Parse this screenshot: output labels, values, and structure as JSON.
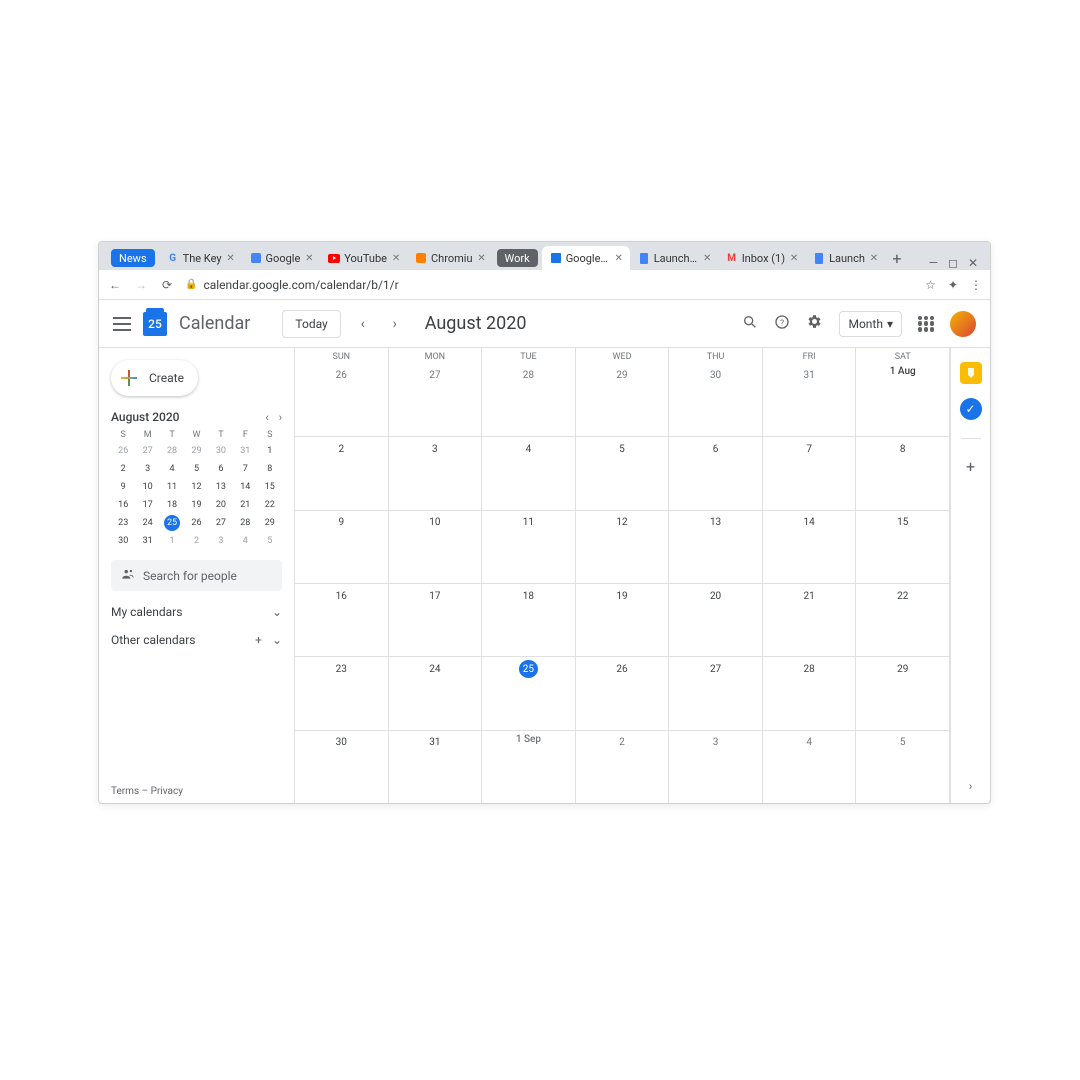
{
  "browser": {
    "tabs": [
      {
        "label": "News",
        "type": "group"
      },
      {
        "label": "The Key",
        "icon": "G"
      },
      {
        "label": "Google",
        "icon": "GB"
      },
      {
        "label": "YouTube",
        "icon": "YT"
      },
      {
        "label": "Chromiu",
        "icon": "B"
      },
      {
        "label": "Work",
        "type": "group"
      },
      {
        "label": "Google C",
        "icon": "CAL",
        "active": true
      },
      {
        "label": "Launch Pr",
        "icon": "DOC"
      },
      {
        "label": "Inbox (1)",
        "icon": "M"
      },
      {
        "label": "Launch",
        "icon": "DOC"
      }
    ],
    "url": "calendar.google.com/calendar/b/1/r"
  },
  "header": {
    "logo_day": "25",
    "app_title": "Calendar",
    "today": "Today",
    "month_title": "August 2020",
    "view": "Month"
  },
  "sidebar": {
    "create": "Create",
    "mini_title": "August 2020",
    "dow": [
      "S",
      "M",
      "T",
      "W",
      "T",
      "F",
      "S"
    ],
    "mini_weeks": [
      [
        {
          "d": "26",
          "m": 1
        },
        {
          "d": "27",
          "m": 1
        },
        {
          "d": "28",
          "m": 1
        },
        {
          "d": "29",
          "m": 1
        },
        {
          "d": "30",
          "m": 1
        },
        {
          "d": "31",
          "m": 1
        },
        {
          "d": "1"
        }
      ],
      [
        {
          "d": "2"
        },
        {
          "d": "3"
        },
        {
          "d": "4"
        },
        {
          "d": "5"
        },
        {
          "d": "6"
        },
        {
          "d": "7"
        },
        {
          "d": "8"
        }
      ],
      [
        {
          "d": "9"
        },
        {
          "d": "10"
        },
        {
          "d": "11"
        },
        {
          "d": "12"
        },
        {
          "d": "13"
        },
        {
          "d": "14"
        },
        {
          "d": "15"
        }
      ],
      [
        {
          "d": "16"
        },
        {
          "d": "17"
        },
        {
          "d": "18"
        },
        {
          "d": "19"
        },
        {
          "d": "20"
        },
        {
          "d": "21"
        },
        {
          "d": "22"
        }
      ],
      [
        {
          "d": "23"
        },
        {
          "d": "24"
        },
        {
          "d": "25",
          "t": 1
        },
        {
          "d": "26"
        },
        {
          "d": "27"
        },
        {
          "d": "28"
        },
        {
          "d": "29"
        }
      ],
      [
        {
          "d": "30"
        },
        {
          "d": "31"
        },
        {
          "d": "1",
          "m": 1
        },
        {
          "d": "2",
          "m": 1
        },
        {
          "d": "3",
          "m": 1
        },
        {
          "d": "4",
          "m": 1
        },
        {
          "d": "5",
          "m": 1
        }
      ]
    ],
    "search_placeholder": "Search for people",
    "my_calendars": "My calendars",
    "other_calendars": "Other calendars",
    "terms": "Terms",
    "privacy": "Privacy"
  },
  "grid": {
    "dow": [
      "SUN",
      "MON",
      "TUE",
      "WED",
      "THU",
      "FRI",
      "SAT"
    ],
    "weeks": [
      [
        {
          "d": "26",
          "m": 1
        },
        {
          "d": "27",
          "m": 1
        },
        {
          "d": "28",
          "m": 1
        },
        {
          "d": "29",
          "m": 1
        },
        {
          "d": "30",
          "m": 1
        },
        {
          "d": "31",
          "m": 1
        },
        {
          "d": "1 Aug",
          "label": 1
        }
      ],
      [
        {
          "d": "2"
        },
        {
          "d": "3"
        },
        {
          "d": "4"
        },
        {
          "d": "5"
        },
        {
          "d": "6"
        },
        {
          "d": "7"
        },
        {
          "d": "8"
        }
      ],
      [
        {
          "d": "9"
        },
        {
          "d": "10"
        },
        {
          "d": "11"
        },
        {
          "d": "12"
        },
        {
          "d": "13"
        },
        {
          "d": "14"
        },
        {
          "d": "15"
        }
      ],
      [
        {
          "d": "16"
        },
        {
          "d": "17"
        },
        {
          "d": "18"
        },
        {
          "d": "19"
        },
        {
          "d": "20"
        },
        {
          "d": "21"
        },
        {
          "d": "22"
        }
      ],
      [
        {
          "d": "23"
        },
        {
          "d": "24"
        },
        {
          "d": "25",
          "t": 1
        },
        {
          "d": "26"
        },
        {
          "d": "27"
        },
        {
          "d": "28"
        },
        {
          "d": "29"
        }
      ],
      [
        {
          "d": "30"
        },
        {
          "d": "31"
        },
        {
          "d": "1 Sep",
          "label": 1,
          "m": 1
        },
        {
          "d": "2",
          "m": 1
        },
        {
          "d": "3",
          "m": 1
        },
        {
          "d": "4",
          "m": 1
        },
        {
          "d": "5",
          "m": 1
        }
      ]
    ]
  }
}
